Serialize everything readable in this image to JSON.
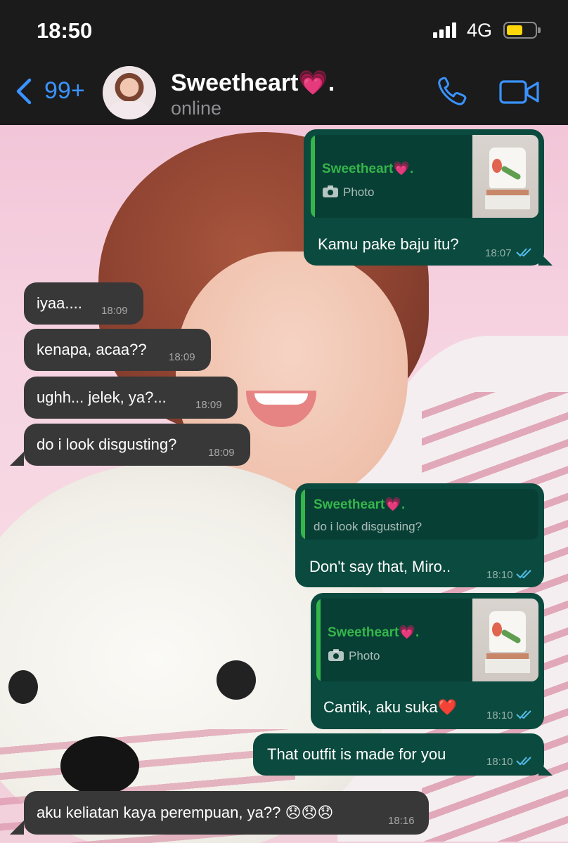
{
  "status_bar": {
    "time": "18:50",
    "network": "4G"
  },
  "header": {
    "back_count": "99+",
    "contact_name": "Sweetheart💗.",
    "contact_status": "online"
  },
  "messages": [
    {
      "direction": "out",
      "reply_to": {
        "name": "Sweetheart💗.",
        "text": "Photo",
        "type": "photo"
      },
      "text": "Kamu pake baju itu?",
      "time": "18:07",
      "status": "read"
    },
    {
      "direction": "in",
      "text": "iyaa....",
      "time": "18:09"
    },
    {
      "direction": "in",
      "text": "kenapa, acaa??",
      "time": "18:09"
    },
    {
      "direction": "in",
      "text": "ughh... jelek, ya?...",
      "time": "18:09"
    },
    {
      "direction": "in",
      "text": "do i look disgusting?",
      "time": "18:09"
    },
    {
      "direction": "out",
      "reply_to": {
        "name": "Sweetheart💗.",
        "text": "do i look disgusting?",
        "type": "text"
      },
      "text": "Don't say that, Miro..",
      "time": "18:10",
      "status": "read"
    },
    {
      "direction": "out",
      "reply_to": {
        "name": "Sweetheart💗.",
        "text": "Photo",
        "type": "photo"
      },
      "text": "Cantik, aku suka❤️",
      "time": "18:10",
      "status": "read"
    },
    {
      "direction": "out",
      "text": "That outfit is made for you",
      "time": "18:10",
      "status": "read"
    },
    {
      "direction": "in",
      "text": "aku keliatan kaya perempuan, ya?? 😞😞😞",
      "time": "18:16"
    }
  ],
  "icons": {
    "back": "chevron-left-icon",
    "call": "phone-icon",
    "video": "video-camera-icon",
    "read_receipt": "double-check-icon",
    "photo": "camera-icon"
  },
  "colors": {
    "accent": "#3a93ff",
    "outgoing_bubble": "#0b4a3e",
    "incoming_bubble": "#383838",
    "reply_name": "#35b64a",
    "read_tick": "#53bdeb"
  }
}
